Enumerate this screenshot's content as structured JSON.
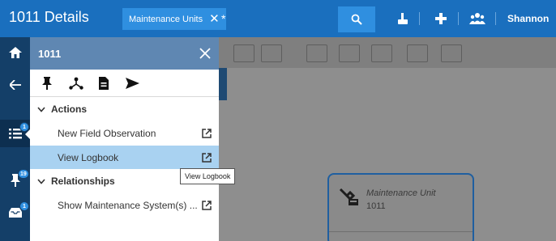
{
  "header": {
    "title": "1011 Details",
    "search_chip": "Maintenance Units",
    "search_value": "*",
    "user": "Shannon"
  },
  "rail": {
    "badges": {
      "list": "1",
      "pins": "19",
      "inbox": "1"
    },
    "icons": [
      "home-icon",
      "back-arrow-icon",
      "list-icon",
      "pin-icon",
      "inbox-icon"
    ]
  },
  "panel": {
    "title": "1011",
    "tools": [
      "pin-icon",
      "hierarchy-icon",
      "document-icon",
      "send-icon"
    ],
    "sections": [
      {
        "label": "Actions",
        "items": [
          {
            "label": "New Field Observation"
          },
          {
            "label": "View Logbook"
          }
        ]
      },
      {
        "label": "Relationships",
        "items": [
          {
            "label": "Show Maintenance System(s) ..."
          }
        ]
      }
    ]
  },
  "tooltip": "View Logbook",
  "card": {
    "title": "Maintenance Unit",
    "subtitle": "1011"
  },
  "colors": {
    "header_bg": "#1a6fbe",
    "rail_bg": "#143f68",
    "panel_header_bg": "#5f87b2",
    "highlight": "#a9d2f1",
    "badge": "#2f8fe0"
  }
}
